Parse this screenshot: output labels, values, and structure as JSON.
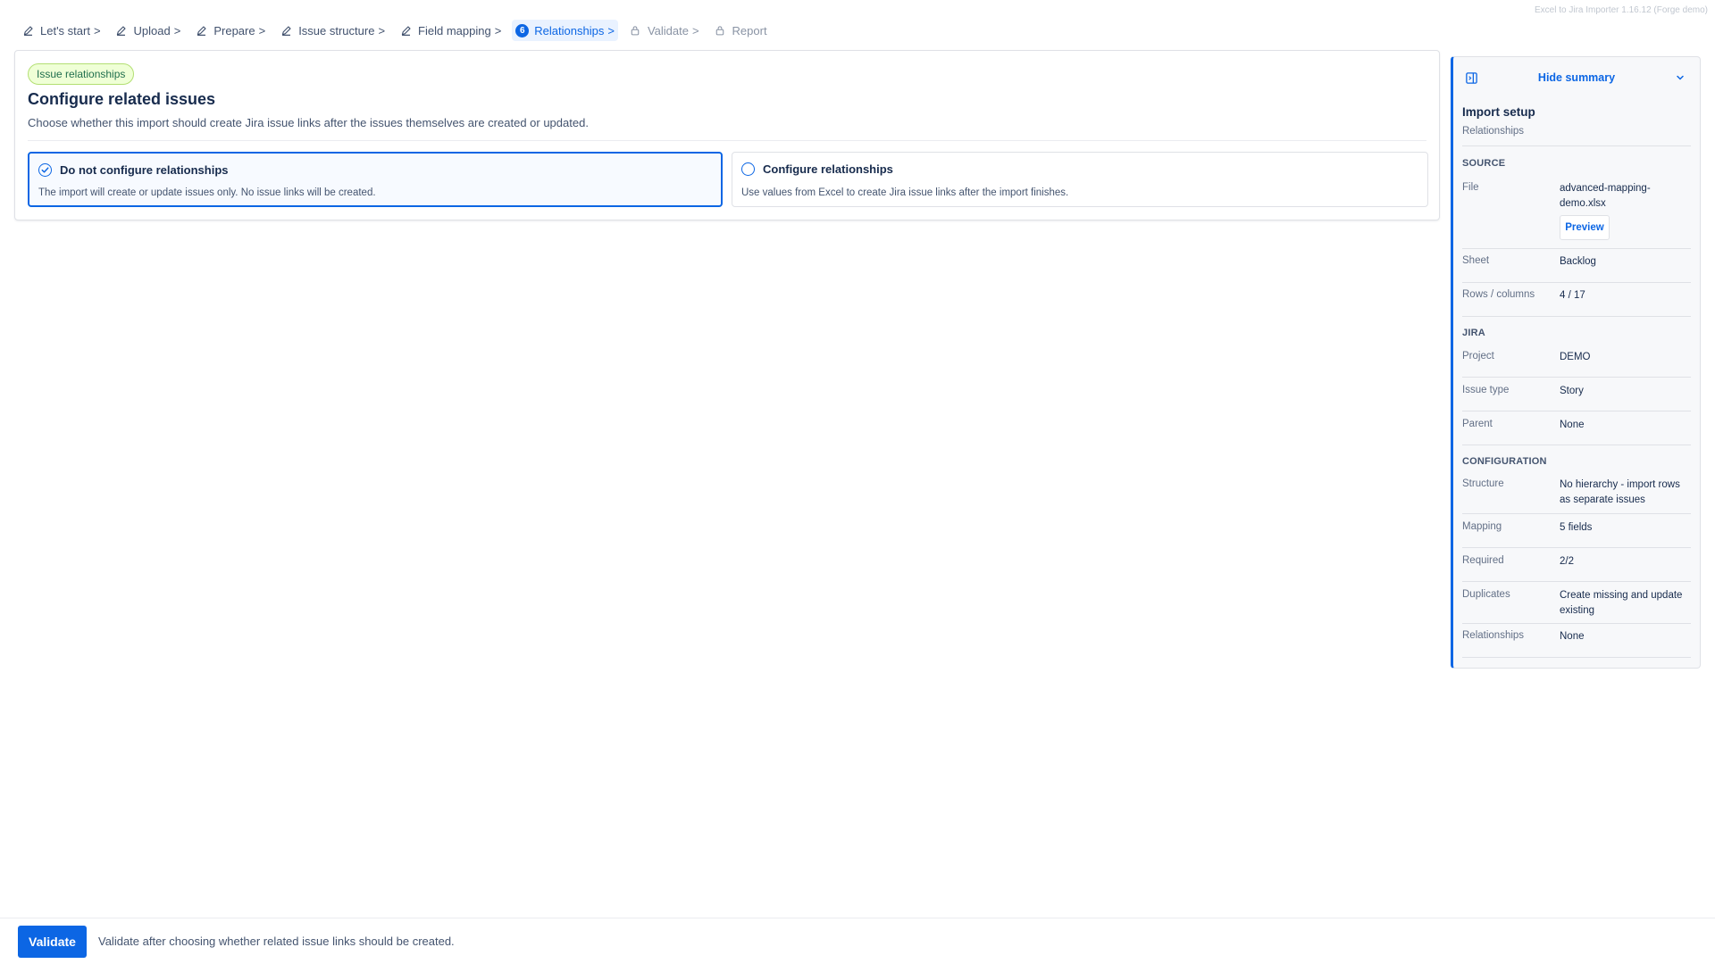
{
  "version": "Excel to Jira Importer 1.16.12 (Forge demo)",
  "stepper": {
    "steps": [
      {
        "label": "Let's start",
        "state": "done",
        "icon": "pencil-icon"
      },
      {
        "label": "Upload",
        "state": "done",
        "icon": "pencil-icon"
      },
      {
        "label": "Prepare",
        "state": "done",
        "icon": "pencil-icon"
      },
      {
        "label": "Issue structure",
        "state": "done",
        "icon": "pencil-icon"
      },
      {
        "label": "Field mapping",
        "state": "done",
        "icon": "pencil-icon"
      },
      {
        "label": "Relationships",
        "state": "active",
        "number": "6"
      },
      {
        "label": "Validate",
        "state": "locked",
        "icon": "lock-icon"
      },
      {
        "label": "Report",
        "state": "locked",
        "icon": "lock-icon"
      }
    ],
    "separator": ">"
  },
  "main": {
    "lozenge": "Issue relationships",
    "title": "Configure related issues",
    "subtitle": "Choose whether this import should create Jira issue links after the issues themselves are created or updated.",
    "options": [
      {
        "title": "Do not configure relationships",
        "description": "The import will create or update issues only. No issue links will be created.",
        "selected": true
      },
      {
        "title": "Configure relationships",
        "description": "Use values from Excel to create Jira issue links after the import finishes.",
        "selected": false
      }
    ]
  },
  "summary": {
    "toggle_label": "Hide summary",
    "title": "Import setup",
    "current_step": "Relationships",
    "source": {
      "heading": "SOURCE",
      "file_label": "File",
      "file_value": "advanced-mapping-demo.xlsx",
      "preview_label": "Preview",
      "sheet_label": "Sheet",
      "sheet_value": "Backlog",
      "rows_label": "Rows / columns",
      "rows_value": "4 / 17"
    },
    "jira": {
      "heading": "JIRA",
      "project_label": "Project",
      "project_value": "DEMO",
      "issue_type_label": "Issue type",
      "issue_type_value": "Story",
      "parent_label": "Parent",
      "parent_value": "None"
    },
    "configuration": {
      "heading": "CONFIGURATION",
      "structure_label": "Structure",
      "structure_value": "No hierarchy - import rows as separate issues",
      "mapping_label": "Mapping",
      "mapping_value": "5 fields",
      "required_label": "Required",
      "required_value": "2/2",
      "duplicates_label": "Duplicates",
      "duplicates_value": "Create missing and update existing",
      "relationships_label": "Relationships",
      "relationships_value": "None"
    }
  },
  "footer": {
    "validate_label": "Validate",
    "hint": "Validate after choosing whether related issue links should be created."
  },
  "colors": {
    "brand": "#0c66e4",
    "lozenge_bg": "#efffd6",
    "lozenge_text": "#216e4e"
  }
}
